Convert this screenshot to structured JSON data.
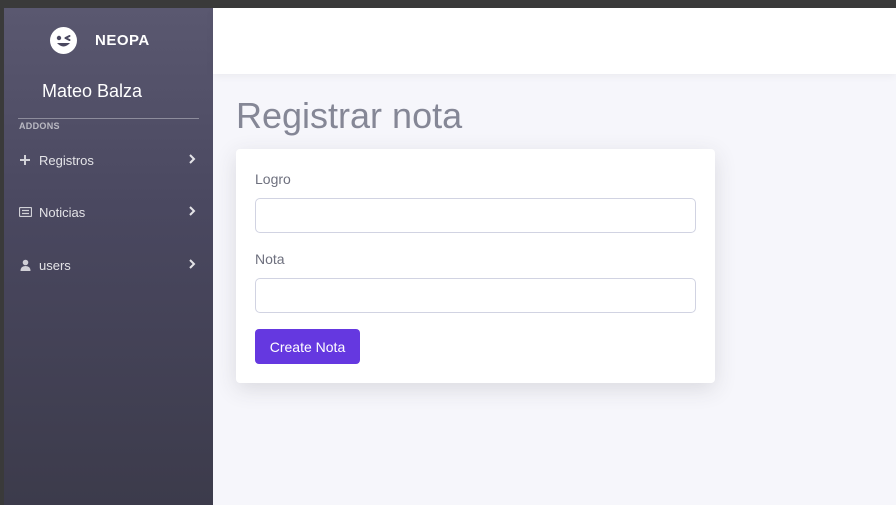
{
  "sidebar": {
    "brand": {
      "name": "NEOPA",
      "logo_icon": "winking-face-icon"
    },
    "user_name": "Mateo Balza",
    "section_label": "ADDONS",
    "items": [
      {
        "label": "Registros",
        "icon": "plus-icon"
      },
      {
        "label": "Noticias",
        "icon": "newspaper-icon"
      },
      {
        "label": "users",
        "icon": "user-icon"
      }
    ]
  },
  "main": {
    "title": "Registrar nota",
    "form": {
      "logro_label": "Logro",
      "logro_value": "",
      "nota_label": "Nota",
      "nota_value": "",
      "submit_label": "Create Nota"
    }
  },
  "colors": {
    "accent": "#6538e0",
    "sidebar_top": "#5a5870",
    "sidebar_bottom": "#3c3b4b",
    "background": "#f6f6fb"
  }
}
